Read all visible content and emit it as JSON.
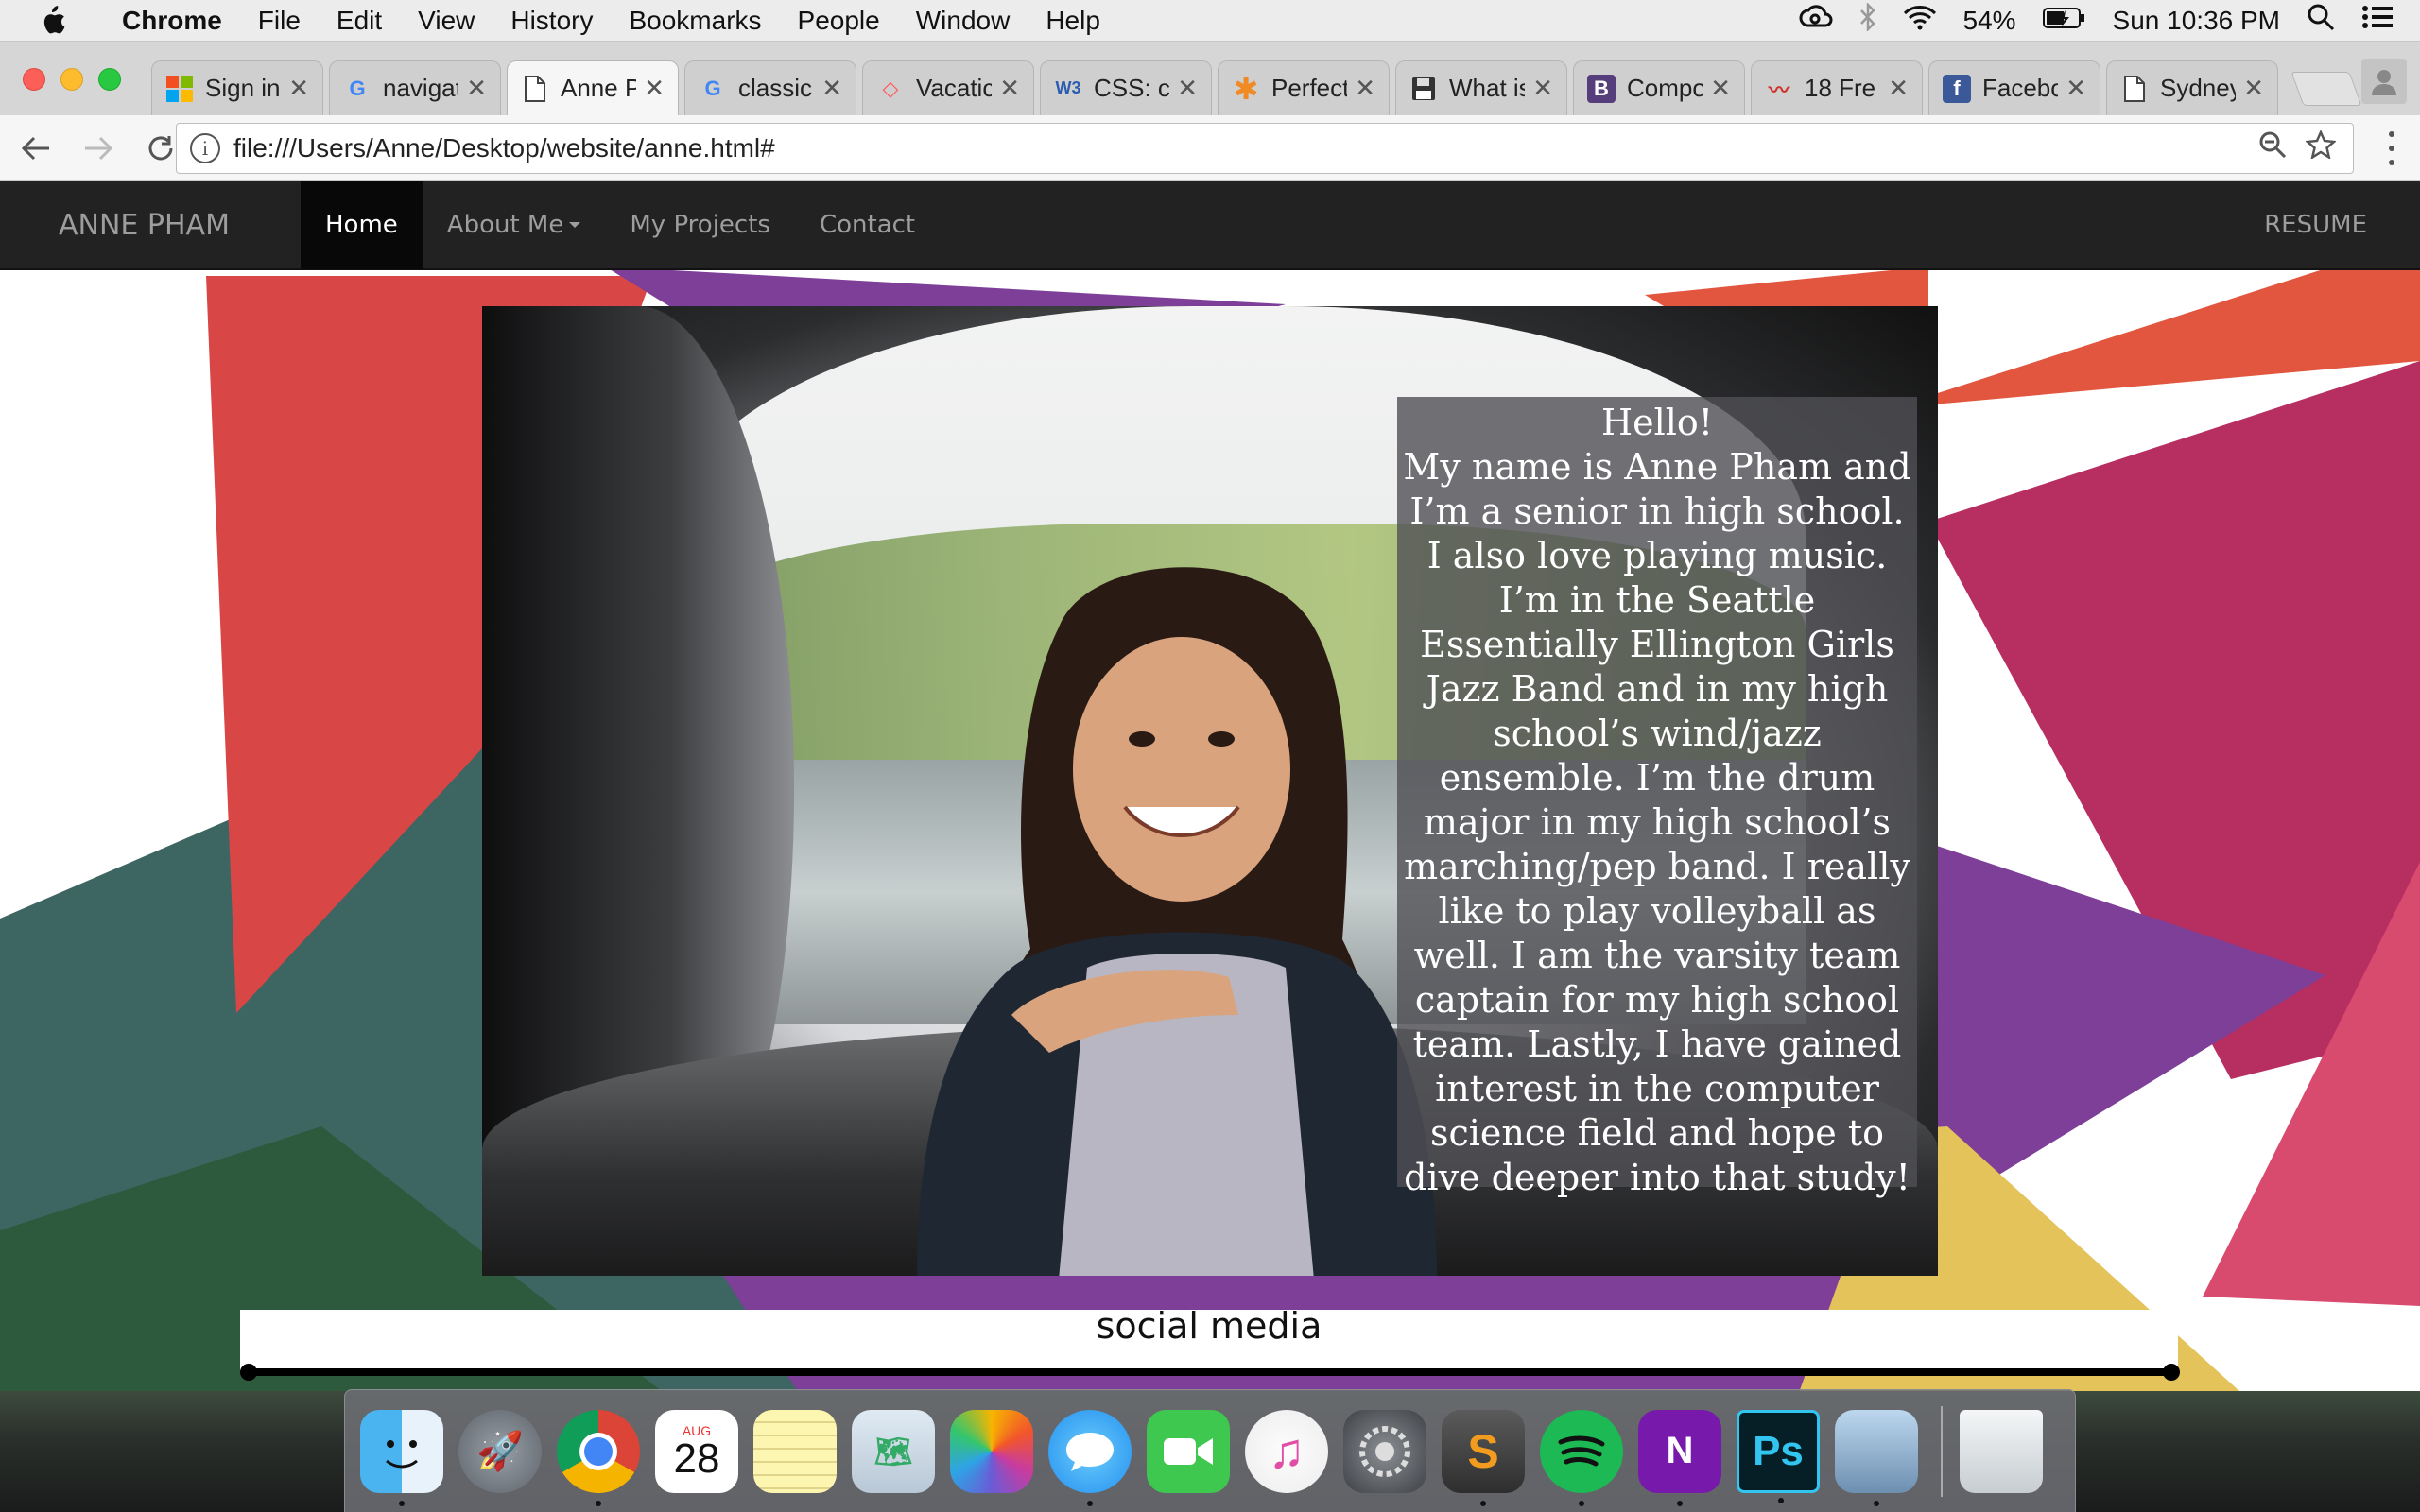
{
  "menubar": {
    "app": "Chrome",
    "items": [
      "File",
      "Edit",
      "View",
      "History",
      "Bookmarks",
      "People",
      "Window",
      "Help"
    ],
    "battery": "54%",
    "clock": "Sun 10:36 PM"
  },
  "tabs": [
    {
      "title": "Sign in",
      "icon": "microsoft-icon"
    },
    {
      "title": "navigat",
      "icon": "google-icon"
    },
    {
      "title": "Anne P",
      "icon": "page-icon",
      "active": true
    },
    {
      "title": "classic",
      "icon": "google-icon"
    },
    {
      "title": "Vacatic",
      "icon": "airbnb-icon"
    },
    {
      "title": "CSS: c",
      "icon": "w3schools-icon"
    },
    {
      "title": "Perfect",
      "icon": "asterisk-icon"
    },
    {
      "title": "What is",
      "icon": "floppy-icon"
    },
    {
      "title": "Compo",
      "icon": "bootstrap-icon"
    },
    {
      "title": "18 Fre",
      "icon": "squiggle-icon"
    },
    {
      "title": "Facebo",
      "icon": "facebook-icon"
    },
    {
      "title": "Sydney",
      "icon": "page-icon"
    }
  ],
  "toolbar": {
    "url": "file:///Users/Anne/Desktop/website/anne.html#"
  },
  "site": {
    "brand": "ANNE PHAM",
    "nav": {
      "home": "Home",
      "about": "About Me",
      "projects": "My Projects",
      "contact": "Contact",
      "resume": "RESUME"
    },
    "intro": {
      "hello": "Hello!",
      "body": "My name is Anne Pham and I’m a senior in high school. I also love playing music. I’m in the Seattle Essentially Ellington Girls Jazz Band and in my high school’s wind/jazz ensemble. I’m the drum major in my high school’s marching/pep band. I really like to play volleyball as well. I am the varsity team captain for my high school team. Lastly, I have gained interest in the computer science field and hope to dive deeper into that study!"
    },
    "social_heading": "social media"
  },
  "dock": {
    "calendar_month": "AUG",
    "calendar_day": "28",
    "apps": [
      "finder",
      "launchpad",
      "chrome",
      "calendar",
      "notes",
      "preview-maps",
      "photos",
      "messages",
      "facetime",
      "itunes",
      "system-preferences",
      "sublime-text",
      "spotify",
      "onenote",
      "photoshop",
      "preview",
      "trash"
    ]
  },
  "colors": {
    "navbar": "#222222",
    "red_shape": "#d94646",
    "purple_shape": "#7d3f98",
    "magenta_shape": "#b72e61",
    "teal_shape": "#3d6663",
    "green_shape": "#2d5a3d",
    "yellow_shape": "#e3c35a"
  }
}
